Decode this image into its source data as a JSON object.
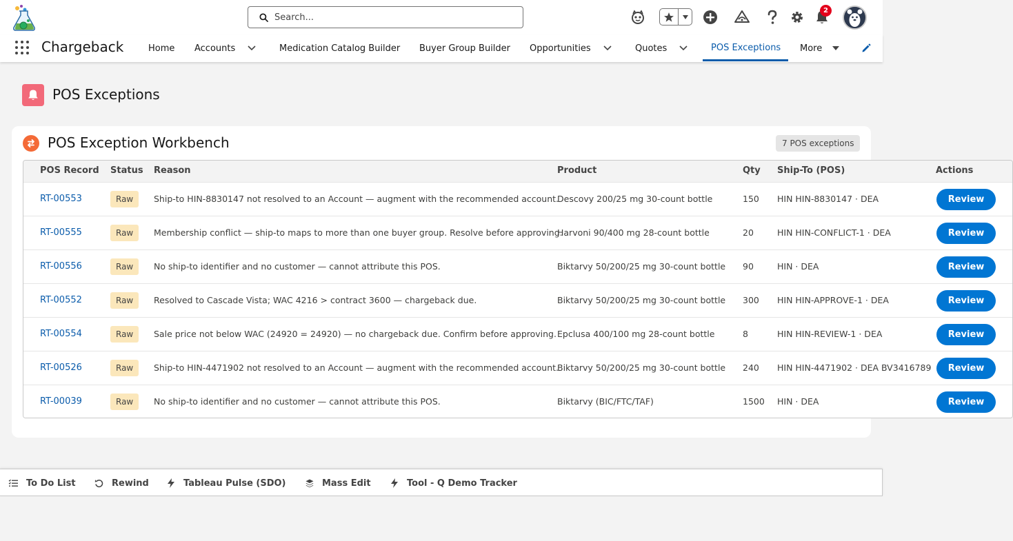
{
  "header": {
    "search_placeholder": "Search...",
    "notification_count": "2"
  },
  "nav": {
    "app_name": "Chargeback",
    "items": [
      {
        "label": "Home"
      },
      {
        "label": "Accounts"
      },
      {
        "label": "Medication Catalog Builder"
      },
      {
        "label": "Buyer Group Builder"
      },
      {
        "label": "Opportunities"
      },
      {
        "label": "Quotes"
      },
      {
        "label": "POS Exceptions"
      },
      {
        "label": "More"
      }
    ],
    "active_item": "POS Exceptions"
  },
  "page": {
    "title": "POS Exceptions"
  },
  "card": {
    "title": "POS Exception Workbench",
    "count_badge": "7 POS exceptions",
    "columns": [
      "POS Record",
      "Status",
      "Reason",
      "Product",
      "Qty",
      "Ship-To (POS)",
      "Actions"
    ],
    "rows": [
      {
        "record": "RT-00553",
        "status": "Raw",
        "reason": "Ship-to HIN-8830147 not resolved to an Account — augment with the recommended account.",
        "product": "Descovy 200/25 mg 30-count bottle",
        "qty": "150",
        "ship_to": "HIN HIN-8830147 · DEA",
        "action": "Review"
      },
      {
        "record": "RT-00555",
        "status": "Raw",
        "reason": "Membership conflict — ship-to maps to more than one buyer group. Resolve before approving.",
        "product": "Harvoni 90/400 mg 28-count bottle",
        "qty": "20",
        "ship_to": "HIN HIN-CONFLICT-1 · DEA",
        "action": "Review"
      },
      {
        "record": "RT-00556",
        "status": "Raw",
        "reason": "No ship-to identifier and no customer — cannot attribute this POS.",
        "product": "Biktarvy 50/200/25 mg 30-count bottle",
        "qty": "90",
        "ship_to": "HIN · DEA",
        "action": "Review"
      },
      {
        "record": "RT-00552",
        "status": "Raw",
        "reason": "Resolved to Cascade Vista; WAC 4216 > contract 3600 — chargeback due.",
        "product": "Biktarvy 50/200/25 mg 30-count bottle",
        "qty": "300",
        "ship_to": "HIN HIN-APPROVE-1 · DEA",
        "action": "Review"
      },
      {
        "record": "RT-00554",
        "status": "Raw",
        "reason": "Sale price not below WAC (24920 = 24920) — no chargeback due. Confirm before approving.",
        "product": "Epclusa 400/100 mg 28-count bottle",
        "qty": "8",
        "ship_to": "HIN HIN-REVIEW-1 · DEA",
        "action": "Review"
      },
      {
        "record": "RT-00526",
        "status": "Raw",
        "reason": "Ship-to HIN-4471902 not resolved to an Account — augment with the recommended account.",
        "product": "Biktarvy 50/200/25 mg 30-count bottle",
        "qty": "240",
        "ship_to": "HIN HIN-4471902 · DEA BV3416789",
        "action": "Review"
      },
      {
        "record": "RT-00039",
        "status": "Raw",
        "reason": "No ship-to identifier and no customer — cannot attribute this POS.",
        "product": "Biktarvy (BIC/FTC/TAF)",
        "qty": "1500",
        "ship_to": "HIN · DEA",
        "action": "Review"
      }
    ]
  },
  "utility_bar": {
    "items": [
      {
        "label": "To Do List",
        "icon": "list-icon"
      },
      {
        "label": "Rewind",
        "icon": "rewind-icon"
      },
      {
        "label": "Tableau Pulse (SDO)",
        "icon": "bolt-icon"
      },
      {
        "label": "Mass Edit",
        "icon": "stack-icon"
      },
      {
        "label": "Tool - Q Demo Tracker",
        "icon": "bolt-icon"
      }
    ]
  },
  "colors": {
    "brand_blue": "#0176d3",
    "link_blue": "#0b5cab",
    "page_icon": "#f26979",
    "card_icon": "#f46a37",
    "status_raw": "#fbe7bb"
  }
}
